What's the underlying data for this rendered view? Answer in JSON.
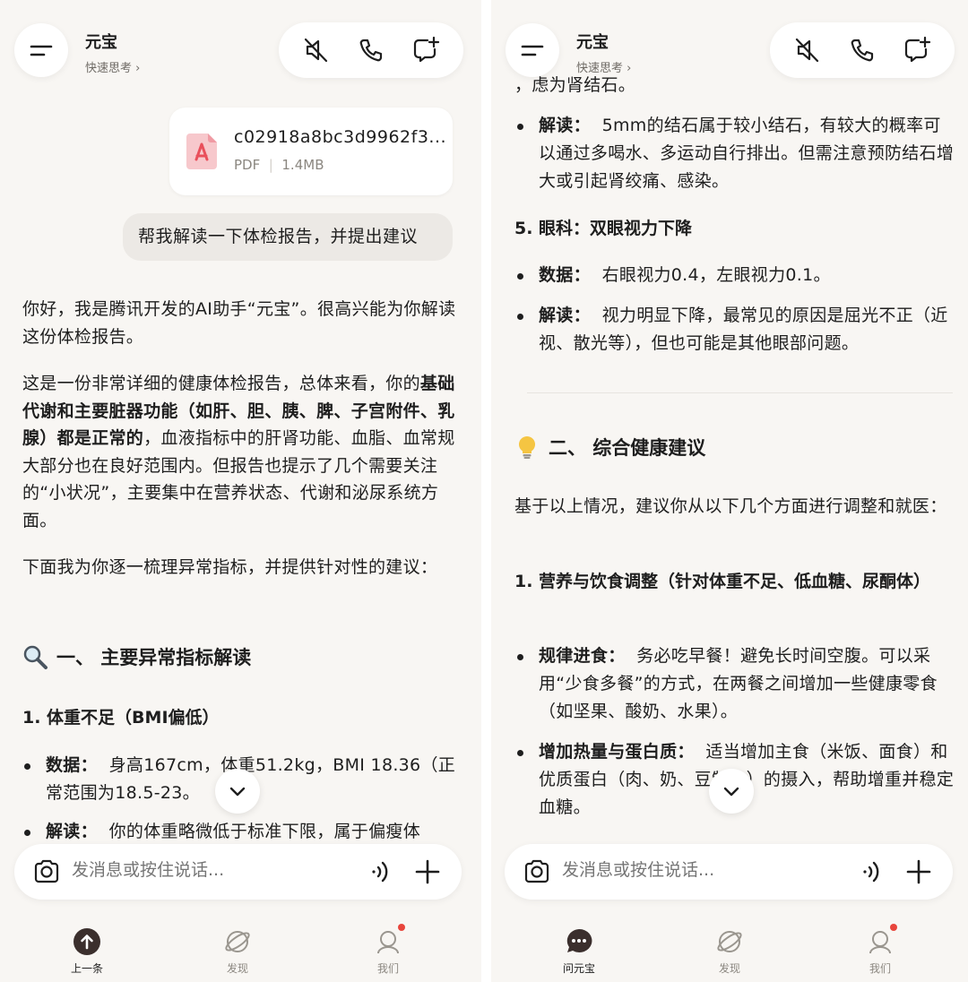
{
  "app": {
    "title": "元宝",
    "subtitle": "快速思考",
    "chevron": "›"
  },
  "left": {
    "file": {
      "name": "c02918a8bc3d9962f3...",
      "type": "PDF",
      "size": "1.4MB"
    },
    "user_message": "帮我解读一下体检报告，并提出建议",
    "intro": "你好，我是腾讯开发的AI助手“元宝”。很高兴能为你解读这份体检报告。",
    "summary_lines": [
      "这是一份非常详细的健康体检报告，总体来看，你的",
      "基础代谢和主要脏器功能（如肝、胆、胰、脾、子宫",
      "附件、乳腺）都是正常的",
      "，血液指标中的肝肾功能、",
      "血脂、血常规大部分也在良好范围内。但报告也提示",
      "了几个需要关注的“小状况”，主要集中在营养状态、",
      "代谢和泌尿系统方面。"
    ],
    "lead_in": "下面我为你逐一梳理异常指标，并提供针对性的建议：",
    "section1_title": "一、 主要异常指标解读",
    "item1_title": "1. 体重不足（BMI偏低）",
    "item1_data_label": "数据：",
    "item1_data": "身高167cm，体重51.2kg，BMI 18.36（正常范围为18.5-23",
    "item1_data_tail": "。",
    "item1_read_label": "解读：",
    "item1_read": "你的体重略微低于标准下限，属于偏瘦体"
  },
  "right": {
    "top_fragment_1": "，虑为肾结石。",
    "read1_label": "解读：",
    "read1": "5mm的结石属于较小结石，有较大的概率可以通过多喝水、多运动自行排出。但需注意预防结石增大或引起肾绞痛、感染。",
    "item5_title": "5. 眼科：双眼视力下降",
    "data5_label": "数据：",
    "data5": "右眼视力0.4，左眼视力0.1。",
    "read5_label": "解读：",
    "read5": "视力明显下降，最常见的原因是屈光不正（近视、散光等），但也可能是其他眼部问题。",
    "section2_title": "二、 综合健康建议",
    "section2_intro": "基于以上情况，建议你从以下几个方面进行调整和就医：",
    "adv1_title": "1. 营养与饮食调整（针对体重不足、低血糖、尿酮体）",
    "adv1a_label": "规律进食：",
    "adv1a": "务必吃早餐！避免长时间空腹。可以采用“少食多餐”的方式，在两餐之间增加一些健康零食（如坚果、酸奶、水果）。",
    "adv1b_label": "增加热量与蛋白质：",
    "adv1b": "适当增加主食（米饭、面食）和优质蛋白（肉、奶、豆制品）的摄入，帮助增重并稳定血糖。"
  },
  "input": {
    "placeholder": "发消息或按住说话..."
  },
  "tabs_left": [
    {
      "label": "上一条"
    },
    {
      "label": "发现"
    },
    {
      "label": "我们"
    }
  ],
  "tabs_right": [
    {
      "label": "问元宝"
    },
    {
      "label": "发现"
    },
    {
      "label": "我们"
    }
  ],
  "colors": {
    "background": "#f8f6f3",
    "pdf_red": "#e94f5b",
    "badge_red": "#e8453c",
    "bulb": "#f5c542"
  },
  "icons": [
    "menu-icon",
    "mute-icon",
    "phone-icon",
    "new-chat-icon",
    "pdf-icon",
    "chevron-down-icon",
    "camera-icon",
    "voice-icon",
    "plus-icon",
    "magnifier-icon",
    "bulb-icon",
    "up-arrow-icon",
    "chat-icon",
    "discover-icon",
    "profile-icon"
  ]
}
